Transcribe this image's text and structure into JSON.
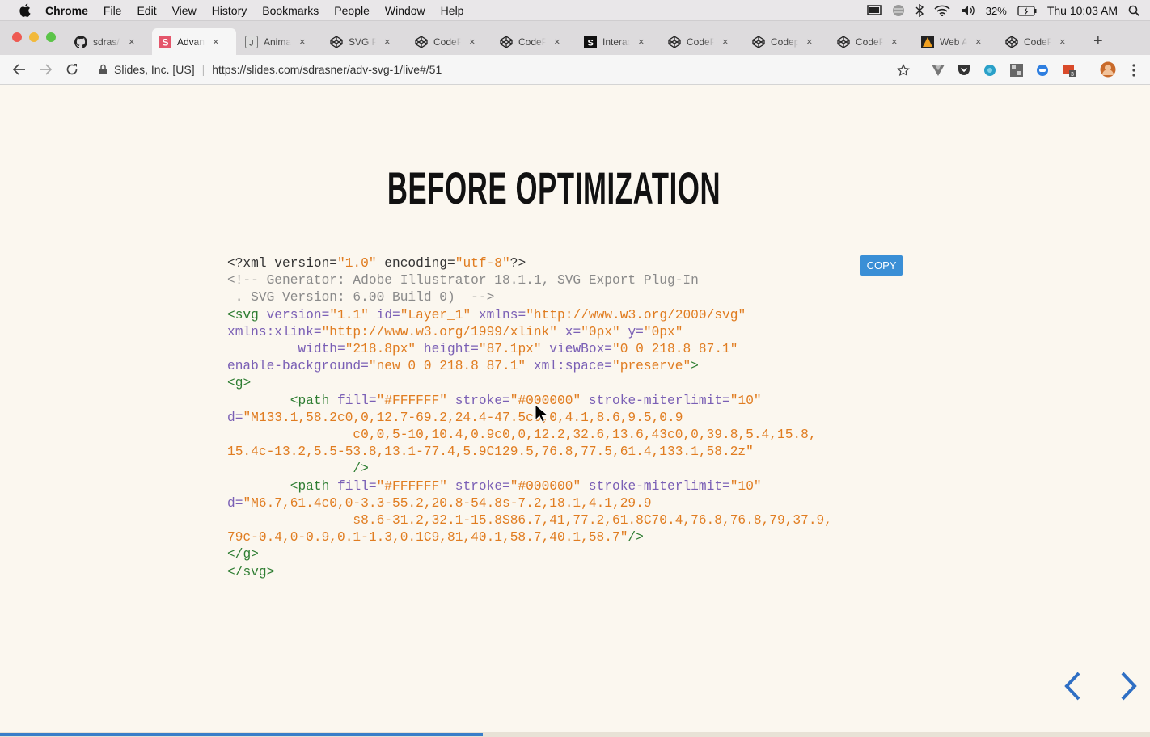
{
  "menubar": {
    "app": "Chrome",
    "items": [
      "File",
      "Edit",
      "View",
      "History",
      "Bookmarks",
      "People",
      "Window",
      "Help"
    ],
    "battery": "32%",
    "clock": "Thu 10:03 AM"
  },
  "tabs": [
    {
      "label": "sdras/",
      "icon": "github-icon",
      "active": false
    },
    {
      "label": "Advanced",
      "icon": "slides-icon",
      "active": true
    },
    {
      "label": "Animat",
      "icon": "j-icon",
      "active": false
    },
    {
      "label": "SVG Pa",
      "icon": "codepen-icon",
      "active": false
    },
    {
      "label": "CodeP",
      "icon": "codepen-icon",
      "active": false
    },
    {
      "label": "CodeP",
      "icon": "codepen-icon",
      "active": false
    },
    {
      "label": "Interac",
      "icon": "s-icon",
      "active": false
    },
    {
      "label": "CodeP",
      "icon": "codepen-icon",
      "active": false
    },
    {
      "label": "Codep",
      "icon": "codepen-icon",
      "active": false
    },
    {
      "label": "CodeP",
      "icon": "codepen-icon",
      "active": false
    },
    {
      "label": "Web A",
      "icon": "web-icon",
      "active": false
    },
    {
      "label": "CodeP",
      "icon": "codepen-icon",
      "active": false
    }
  ],
  "tab_close": "×",
  "new_tab": "+",
  "omnibox": {
    "org": "Slides, Inc. [US]",
    "separator": "|",
    "url": "https://slides.com/sdrasner/adv-svg-1/live#/51"
  },
  "slide": {
    "title": "BEFORE OPTIMIZATION",
    "copy_label": "COPY",
    "code": {
      "l1_a": "<?xml version=",
      "l1_b": "\"1.0\"",
      "l1_c": " encoding=",
      "l1_d": "\"utf-8\"",
      "l1_e": "?>",
      "l2": "<!-- Generator: Adobe Illustrator 18.1.1, SVG Export Plug-In",
      "l3": " . SVG Version: 6.00 Build 0)  -->",
      "l4_a": "<",
      "l4_tag": "svg",
      "l4_b": " version=",
      "l4_c": "\"1.1\"",
      "l4_d": " id=",
      "l4_e": "\"Layer_1\"",
      "l4_f": " xmlns=",
      "l4_g": "\"http://www.w3.org/2000/svg\"",
      "l5_a": "xmlns:xlink=",
      "l5_b": "\"http://www.w3.org/1999/xlink\"",
      "l5_c": " x=",
      "l5_d": "\"0px\"",
      "l5_e": " y=",
      "l5_f": "\"0px\"",
      "l6_a": "         width=",
      "l6_b": "\"218.8px\"",
      "l6_c": " height=",
      "l6_d": "\"87.1px\"",
      "l6_e": " viewBox=",
      "l6_f": "\"0 0 218.8 87.1\"",
      "l7_a": "enable-background=",
      "l7_b": "\"new 0 0 218.8 87.1\"",
      "l7_c": " xml:space=",
      "l7_d": "\"preserve\"",
      "l7_e": ">",
      "l8_a": "<",
      "l8_tag": "g",
      "l8_b": ">",
      "p1_a": "        <",
      "p1_tag": "path",
      "p1_b": " fill=",
      "p1_c": "\"#FFFFFF\"",
      "p1_d": " stroke=",
      "p1_e": "\"#000000\"",
      "p1_f": " stroke-miterlimit=",
      "p1_g": "\"10\"",
      "p1_d1a": "d=",
      "p1_d1b": "\"M133.1,58.2c0,0,12.7-69.2,24.4-47.5c0,0,4.1,8.6,9.5,0.9",
      "p1_d2": "                c0,0,5-10,10.4,0.9c0,0,12.2,32.6,13.6,43c0,0,39.8,5.4,15.8,",
      "p1_d3": "15.4c-13.2,5.5-53.8,13.1-77.4,5.9C129.5,76.8,77.5,61.4,133.1,58.2z\"",
      "p1_end": "                />",
      "p2_d1b": "\"M6.7,61.4c0,0-3.3-55.2,20.8-54.8s-7.2,18.1,4.1,29.9",
      "p2_d2": "                s8.6-31.2,32.1-15.8S86.7,41,77.2,61.8C70.4,76.8,76.8,79,37.9,",
      "p2_d3": "79c-0.4,0-0.9,0.1-1.3,0.1C9,81,40.1,58.7,40.1,58.7\"",
      "p2_end": "/>",
      "close_g_a": "</",
      "close_g_tag": "g",
      "close_g_b": ">",
      "close_svg_a": "</",
      "close_svg_tag": "svg",
      "close_svg_b": ">"
    }
  },
  "progress": 0.42,
  "colors": {
    "accent": "#3a8fd6",
    "nav_arrow": "#2f6fc4",
    "tag": "#2e7d32",
    "attr_value": "#e07c20",
    "comment": "#8a8a8a",
    "background": "#fbf7ef"
  }
}
